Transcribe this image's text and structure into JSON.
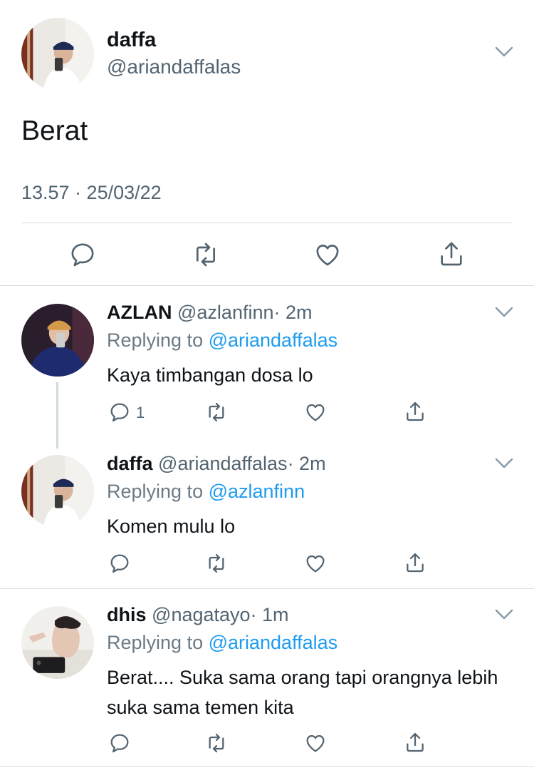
{
  "main_tweet": {
    "name": "daffa",
    "handle": "@ariandaffalas",
    "text": "Berat",
    "timestamp": "13.57 · 25/03/22",
    "actions": [
      "reply-icon",
      "retweet-icon",
      "like-icon",
      "share-icon"
    ]
  },
  "replies": [
    {
      "name": "AZLAN",
      "handle": "@azlanfinn",
      "time": "· 2m",
      "replying_label": "Replying to ",
      "replying_to": "@ariandaffalas",
      "text": "Kaya timbangan dosa lo",
      "reply_count": "1"
    },
    {
      "name": "daffa",
      "handle": "@ariandaffalas",
      "time": "· 2m",
      "replying_label": "Replying to ",
      "replying_to": "@azlanfinn",
      "text": "Komen mulu lo",
      "reply_count": ""
    },
    {
      "name": "dhis",
      "handle": "@nagatayo",
      "time": "· 1m",
      "replying_label": "Replying to ",
      "replying_to": "@ariandaffalas",
      "text": "Berat.... Suka sama orang tapi orangnya lebih suka sama temen kita",
      "reply_count": ""
    }
  ],
  "colors": {
    "text": "#0f1419",
    "secondary": "#536471",
    "mention": "#1d9bf0",
    "divider": "#d9dde1"
  }
}
